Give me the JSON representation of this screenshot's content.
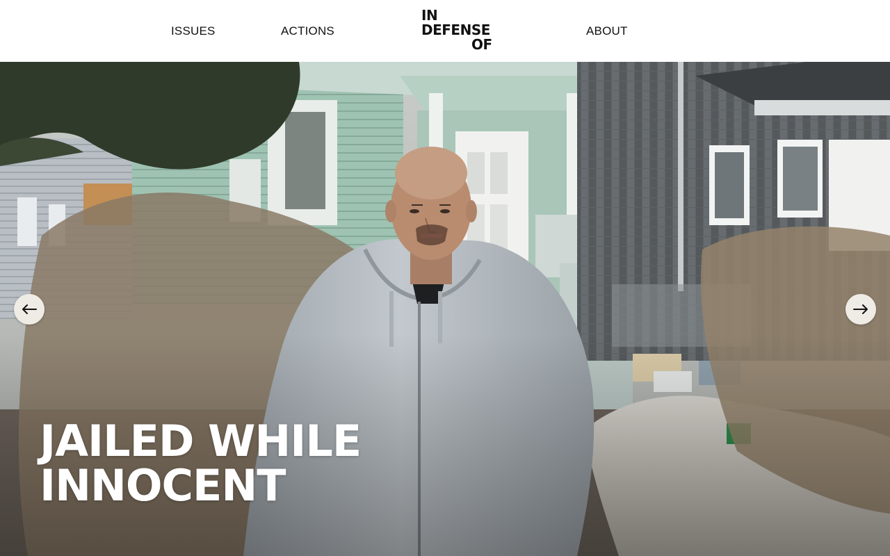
{
  "header": {
    "nav_left": [
      {
        "label": "ISSUES"
      },
      {
        "label": "ACTIONS"
      }
    ],
    "logo_lines": [
      "IN",
      "DEFENSE",
      "OF"
    ],
    "nav_right": [
      {
        "label": "ABOUT"
      }
    ]
  },
  "hero": {
    "title_lines": [
      "JAILED WHILE",
      "INNOCENT"
    ],
    "prev_icon": "arrow-left-icon",
    "next_icon": "arrow-right-icon"
  },
  "colors": {
    "header_bg": "#ffffff",
    "text": "#111111",
    "carousel_button_bg": "#efece6",
    "hero_title": "#ffffff"
  }
}
